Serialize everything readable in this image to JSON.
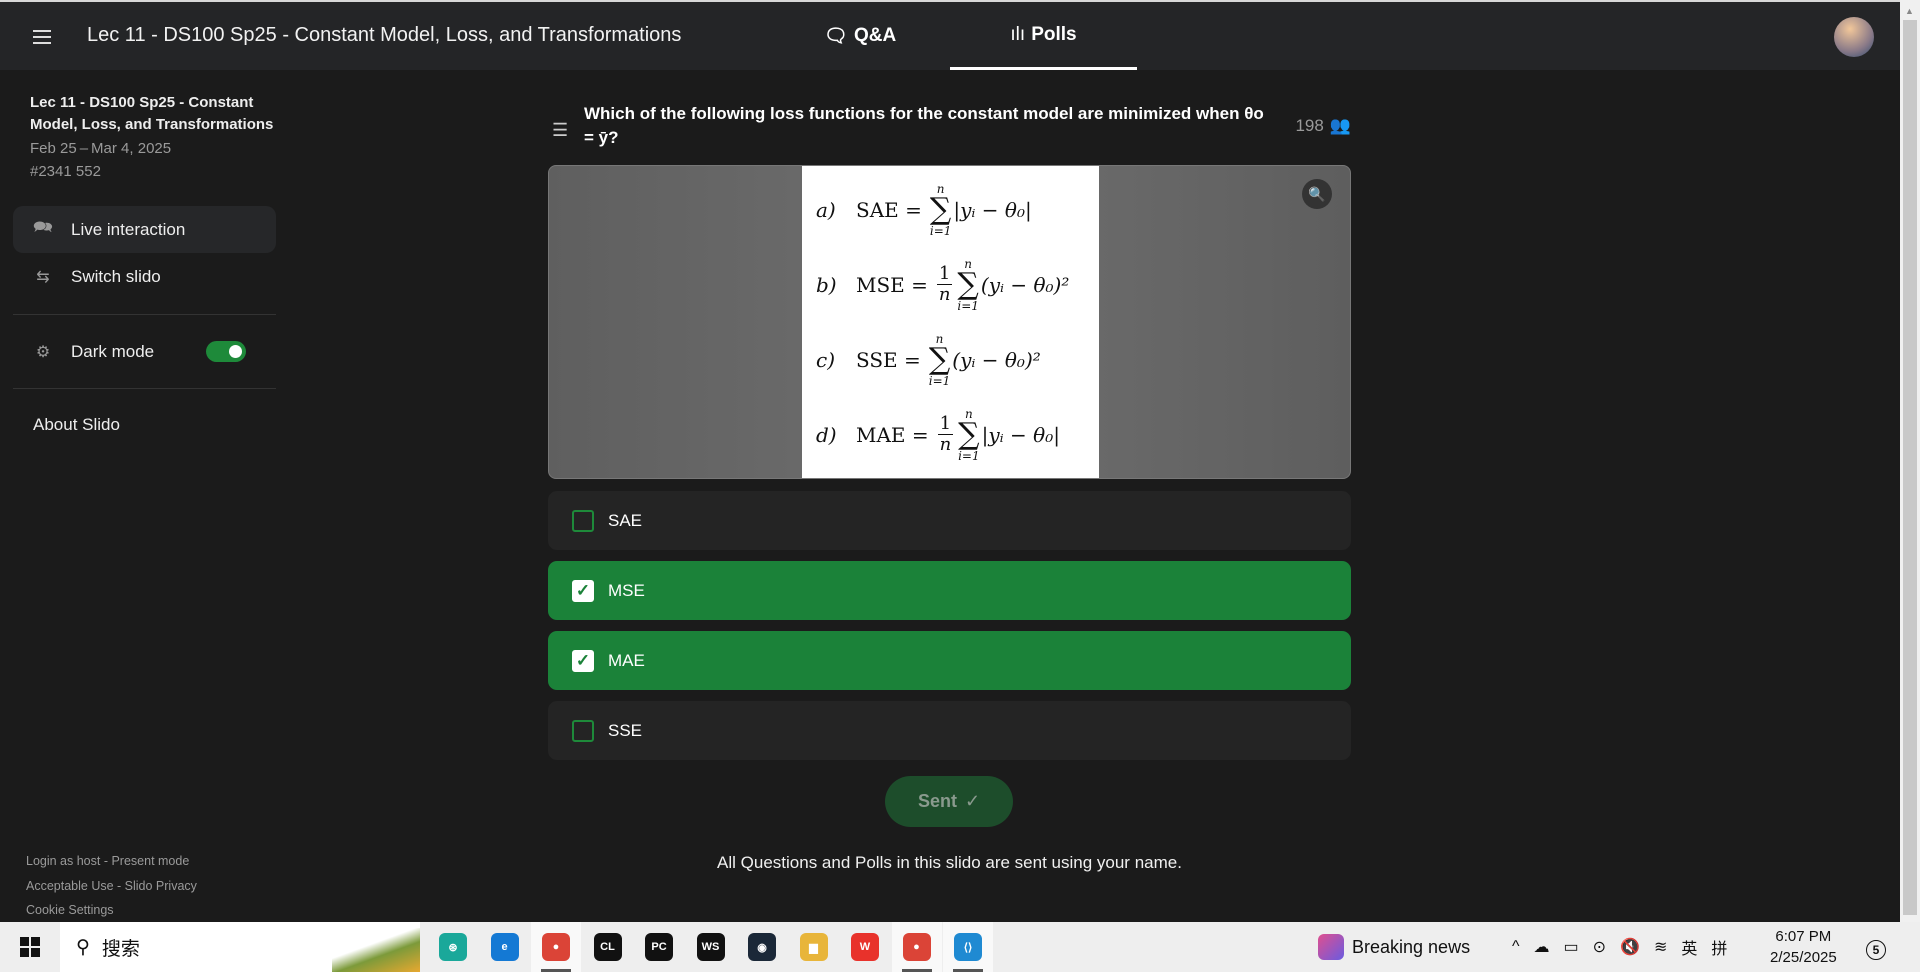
{
  "header": {
    "title": "Lec 11 - DS100 Sp25 - Constant Model, Loss, and Transformations",
    "tabs": [
      {
        "label": "Q&A",
        "icon": "speech-bubble-icon"
      },
      {
        "label": "Polls",
        "icon": "bar-chart-icon",
        "active": true
      }
    ]
  },
  "sidebar": {
    "event_title": "Lec 11 - DS100 Sp25 - Constant Model, Loss, and Transformations",
    "dates": "Feb 25 – Mar 4, 2025",
    "code": "#2341 552",
    "items": [
      {
        "label": "Live interaction",
        "icon": "chat-bubbles-icon"
      },
      {
        "label": "Switch slido",
        "icon": "swap-arrows-icon"
      },
      {
        "label": "Dark mode",
        "icon": "brightness-icon",
        "toggle": true
      }
    ],
    "about": "About Slido",
    "footer": [
      "Login as host - Present mode",
      "Acceptable Use - Slido Privacy",
      "Cookie Settings"
    ]
  },
  "poll": {
    "question": "Which of the following loss functions for the constant model are minimized when θo = ȳ?",
    "participants": "198",
    "formulas": [
      {
        "label": "a)",
        "name": "SAE =",
        "frac": null,
        "top": "n",
        "bot": "i=1",
        "body": "|yᵢ − θ₀|"
      },
      {
        "label": "b)",
        "name": "MSE =",
        "frac": [
          "1",
          "n"
        ],
        "top": "n",
        "bot": "i=1",
        "body": "(yᵢ − θ₀)²"
      },
      {
        "label": "c)",
        "name": "SSE =",
        "frac": null,
        "top": "n",
        "bot": "i=1",
        "body": "(yᵢ − θ₀)²"
      },
      {
        "label": "d)",
        "name": "MAE =",
        "frac": [
          "1",
          "n"
        ],
        "top": "n",
        "bot": "i=1",
        "body": "|yᵢ − θ₀|"
      }
    ],
    "sigma": "∑",
    "options": [
      {
        "label": "SAE",
        "checked": false
      },
      {
        "label": "MSE",
        "checked": true
      },
      {
        "label": "MAE",
        "checked": true
      },
      {
        "label": "SSE",
        "checked": false
      }
    ],
    "check": "✓",
    "sent_label": "Sent",
    "sent_icon": "✓",
    "notice": "All Questions and Polls in this slido are sent using your name."
  },
  "taskbar": {
    "search": "搜索",
    "apps": [
      {
        "name": "brain-app",
        "text": "⊛",
        "color": "#1aa89a"
      },
      {
        "name": "edge",
        "text": "e",
        "color": "#1479d4"
      },
      {
        "name": "chrome-profile",
        "text": "●",
        "color": "#db4437",
        "running": true
      },
      {
        "name": "clion",
        "text": "CL",
        "color": "#111"
      },
      {
        "name": "pycharm",
        "text": "PC",
        "color": "#111"
      },
      {
        "name": "webstorm",
        "text": "WS",
        "color": "#111"
      },
      {
        "name": "steam",
        "text": "◉",
        "color": "#1b2838"
      },
      {
        "name": "file-explorer",
        "text": "▆",
        "color": "#e8b53a"
      },
      {
        "name": "wps",
        "text": "W",
        "color": "#e8322b"
      },
      {
        "name": "chrome",
        "text": "●",
        "color": "#db4437",
        "running": true
      },
      {
        "name": "vscode",
        "text": "⟨⟩",
        "color": "#1f8ad2",
        "running": true
      }
    ],
    "news": "Breaking news",
    "tray": [
      "^",
      "☁",
      "▭",
      "⊙",
      "🔇",
      "≋",
      "英",
      "拼"
    ],
    "time": "6:07 PM",
    "date": "2/25/2025",
    "notifications": "5"
  }
}
